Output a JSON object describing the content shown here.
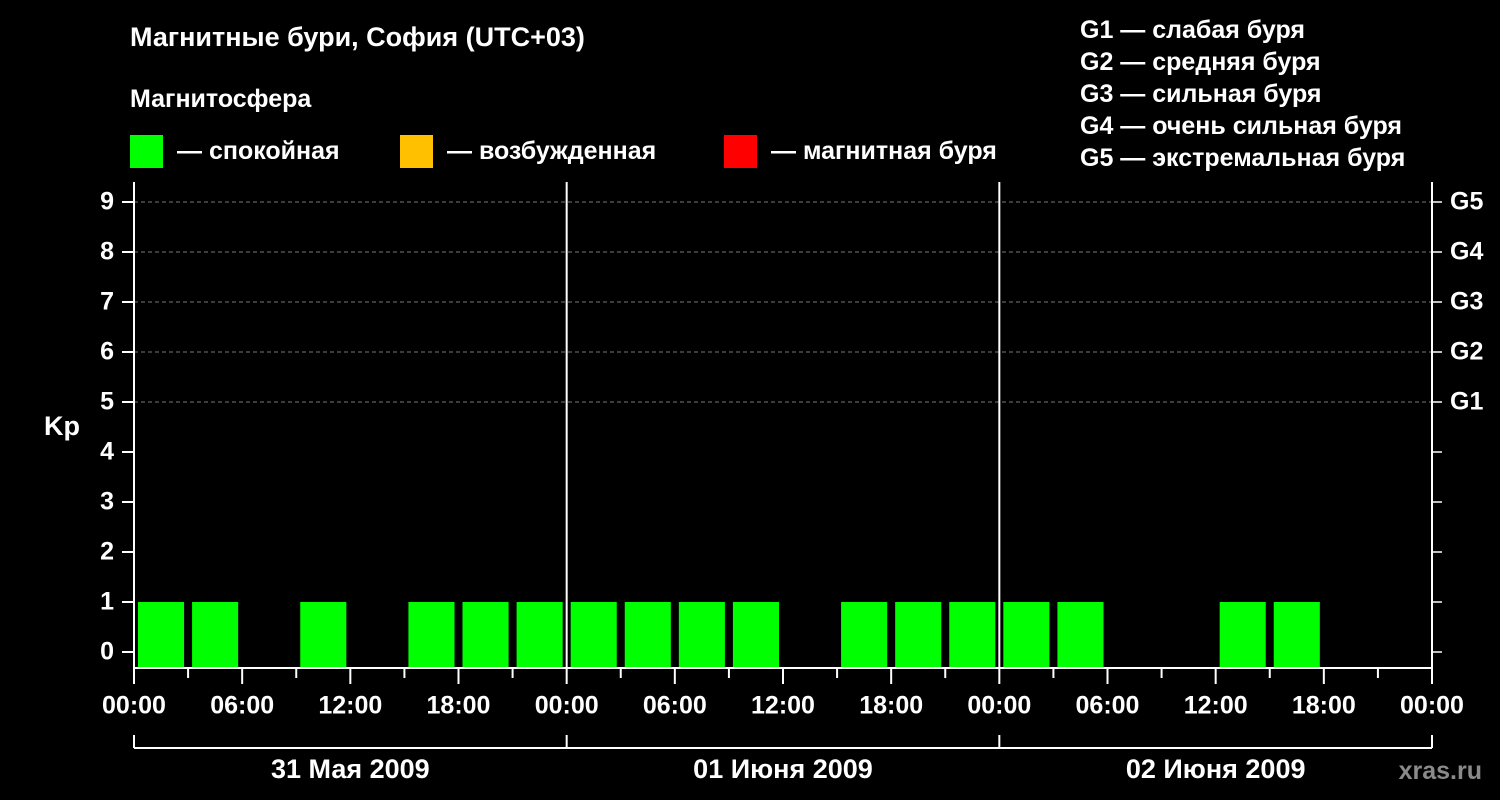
{
  "header": {
    "title": "Магнитные бури, София (UTC+03)",
    "subtitle": "Магнитосфера"
  },
  "legend": [
    {
      "label": "— спокойная",
      "color": "#00ff00"
    },
    {
      "label": "— возбужденная",
      "color": "#ffc000"
    },
    {
      "label": "— магнитная буря",
      "color": "#ff0000"
    }
  ],
  "g_legend": [
    "G1 — слабая буря",
    "G2 — средняя буря",
    "G3 — сильная буря",
    "G4 — очень сильная буря",
    "G5 — экстремальная буря"
  ],
  "watermark": "xras.ru",
  "chart_data": {
    "type": "bar",
    "ylabel": "Kp",
    "ylim": [
      0,
      9
    ],
    "yticks": [
      "0",
      "1",
      "2",
      "3",
      "4",
      "5",
      "6",
      "7",
      "8",
      "9"
    ],
    "right_ticks": [
      {
        "kp": 5,
        "label": "G1"
      },
      {
        "kp": 6,
        "label": "G2"
      },
      {
        "kp": 7,
        "label": "G3"
      },
      {
        "kp": 8,
        "label": "G4"
      },
      {
        "kp": 9,
        "label": "G5"
      }
    ],
    "xticks": [
      "00:00",
      "06:00",
      "12:00",
      "18:00",
      "00:00",
      "06:00",
      "12:00",
      "18:00",
      "00:00",
      "06:00",
      "12:00",
      "18:00",
      "00:00"
    ],
    "days": [
      "31 Мая 2009",
      "01 Июня 2009",
      "02 Июня 2009"
    ],
    "interval_hours": 3,
    "values": [
      1,
      1,
      0,
      1,
      0,
      1,
      1,
      1,
      1,
      1,
      1,
      1,
      0,
      1,
      1,
      1,
      1,
      1,
      0,
      0,
      1,
      1,
      0,
      0
    ],
    "bar_color": "#00ff00",
    "grid": "dashed at Kp 5–9"
  }
}
